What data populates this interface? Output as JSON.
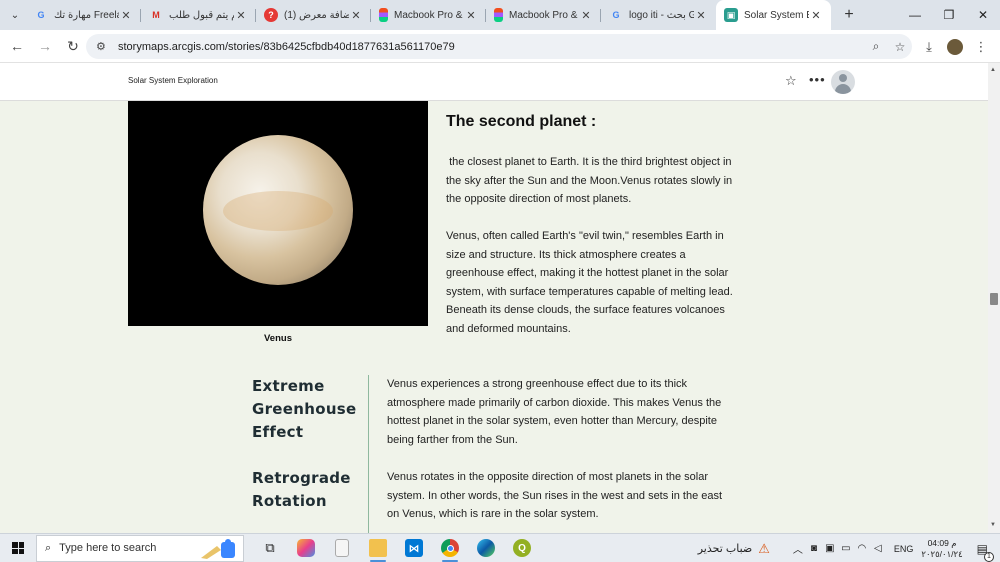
{
  "browser": {
    "tabs": [
      {
        "title": "مهارة تك Freelancer",
        "favicon": "google",
        "active": false
      },
      {
        "title": "لم يتم قبول طلب...",
        "favicon": "gmail",
        "active": false
      },
      {
        "title": "(1) إضافة معرض...",
        "favicon": "red",
        "active": false
      },
      {
        "title": "Macbook Pro &",
        "favicon": "figma",
        "active": false
      },
      {
        "title": "Macbook Pro &",
        "favicon": "figma",
        "active": false
      },
      {
        "title": "logo iti - بحث G",
        "favicon": "google",
        "active": false
      },
      {
        "title": "Solar System Ex",
        "favicon": "arcgis",
        "active": true
      }
    ],
    "url": "storymaps.arcgis.com/stories/83b6425cfbdb40d1877631a561170e79"
  },
  "page_header": {
    "story_title": "Solar System Exploration"
  },
  "content": {
    "image_caption": "Venus",
    "section_title": "The second planet :",
    "paragraph_1": " the closest planet to Earth. It is the third brightest object in the sky after the Sun and the Moon.Venus rotates slowly in the opposite direction of most planets.",
    "paragraph_2": "Venus, often called Earth's \"evil twin,\" resembles Earth in size and structure. Its thick atmosphere creates a greenhouse effect, making it the hottest planet in the solar system, with surface temperatures capable of melting lead. Beneath its dense clouds, the surface features volcanoes and deformed mountains.",
    "facts": [
      {
        "term": "Extreme Greenhouse Effect",
        "definition": "Venus experiences a strong greenhouse effect due to its thick atmosphere made primarily of carbon dioxide. This makes Venus the hottest planet in the solar system, even hotter than Mercury, despite being farther from the Sun."
      },
      {
        "term": "Retrograde Rotation",
        "definition": "Venus rotates in the opposite direction of most planets in the solar system. In other words, the Sun rises in the west and sets in the east on Venus, which is rare in the solar system."
      }
    ]
  },
  "taskbar": {
    "search_placeholder": "Type here to search",
    "weather": "ضباب تحذير",
    "language": "ENG",
    "time": "04:09 م",
    "date": "٢٠٢٥/٠١/٢٤",
    "notification_count": "1"
  },
  "colors": {
    "page_bg": "#f0f3ea",
    "divider": "#8fb89e",
    "heading": "#1f2d33"
  }
}
